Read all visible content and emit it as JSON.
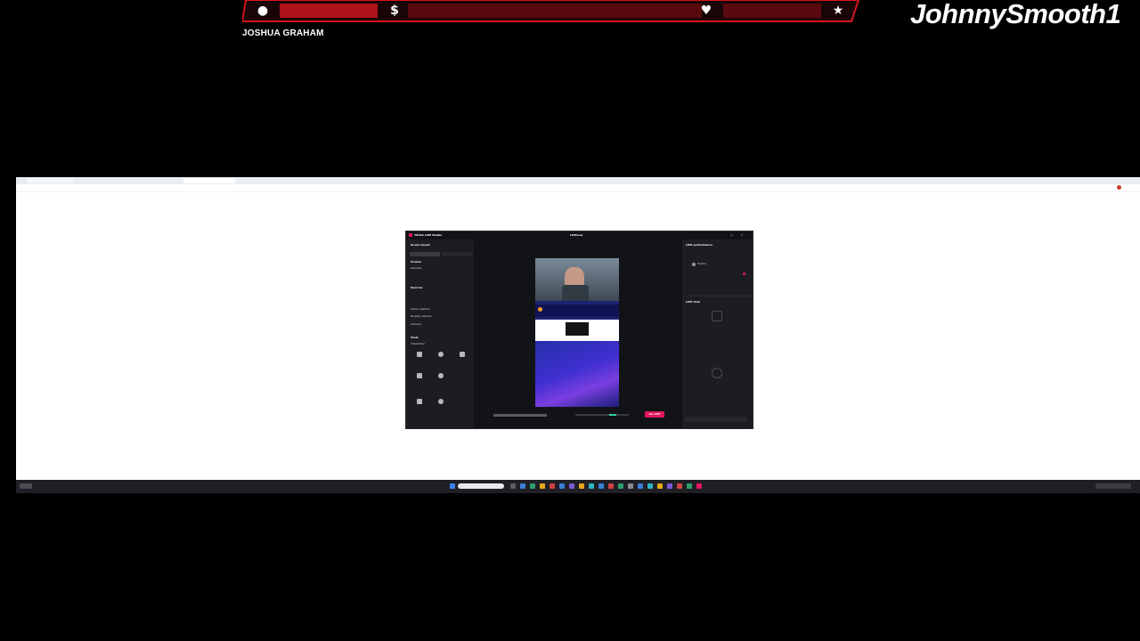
{
  "overlay": {
    "streamer_name": "JOSHUA GRAHAM",
    "channel_name": "JohnnySmooth1",
    "icons": [
      "user-icon",
      "dollar-icon",
      "heart-icon",
      "star-icon"
    ],
    "dollar_glyph": "$",
    "accent_color": "#d4141b"
  },
  "browser": {
    "tabs": [
      "",
      "",
      "",
      ""
    ]
  },
  "studio": {
    "title": "TikTok LIVE Studio",
    "center_title": "LIVEnow",
    "scene_layout_label": "Scene layout",
    "scenes_label": "Scenes",
    "scene_items": [
      "General",
      ""
    ],
    "sources_label": "Sources",
    "source_items": [
      "",
      "",
      "Game capture",
      "Display capture",
      "Camera"
    ],
    "tools_label": "Tools",
    "interaction_label": "Interaction",
    "tool_items": [
      "",
      "",
      "",
      "",
      ""
    ],
    "right_top_label": "LIVE performance",
    "host_name": "Supire",
    "live_chat_label": "LIVE chat",
    "go_live_label": "Go LIVE",
    "brand_color": "#e3165b"
  }
}
